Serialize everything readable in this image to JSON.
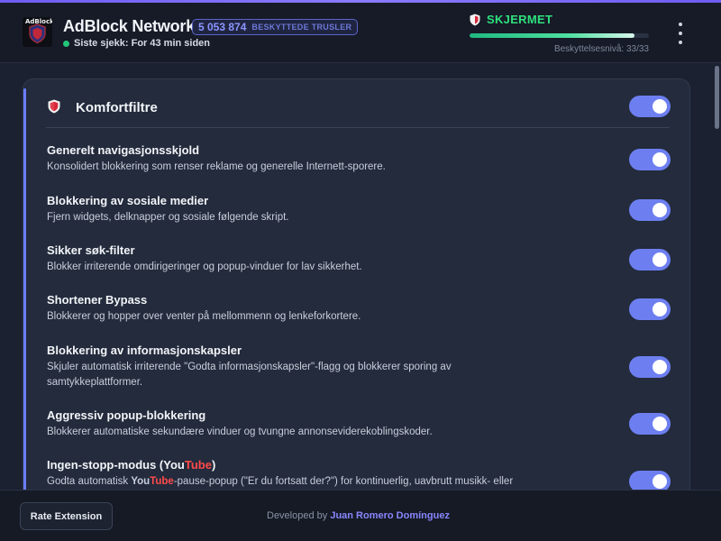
{
  "header": {
    "logo_text": "AdBlock",
    "title": "AdBlock Network",
    "threat_count": "5 053 874",
    "threat_label": "BESKYTTEDE TRUSLER",
    "last_check": "Siste sjekk: For 43 min siden",
    "status": "SKJERMET",
    "protection_level": "Beskyttelsesnivå: 33/33",
    "protection_fraction": 0.92
  },
  "card": {
    "title": "Komfortfiltre",
    "enabled": true,
    "filters": [
      {
        "title": "Generelt navigasjonsskjold",
        "desc": "Konsolidert blokkering som renser reklame og generelle Internett-sporere.",
        "enabled": true
      },
      {
        "title": "Blokkering av sosiale medier",
        "desc": "Fjern widgets, delknapper og sosiale følgende skript.",
        "enabled": true
      },
      {
        "title": "Sikker søk-filter",
        "desc": "Blokker irriterende omdirigeringer og popup-vinduer for lav sikkerhet.",
        "enabled": true
      },
      {
        "title": "Shortener Bypass",
        "desc": "Blokkerer og hopper over venter på mellommenn og lenkeforkortere.",
        "enabled": true
      },
      {
        "title": "Blokkering av informasjonskapsler",
        "desc": "Skjuler automatisk irriterende \"Godta informasjonskapsler\"-flagg og blokkerer sporing av samtykkeplattformer.",
        "enabled": true
      },
      {
        "title": "Aggressiv popup-blokkering",
        "desc": "Blokkerer automatiske sekundære vinduer og tvungne annonseviderekoblingskoder.",
        "enabled": true
      }
    ],
    "youtube_filter": {
      "title_before": "Ingen-stopp-modus (",
      "title_you": "You",
      "title_tube": "Tube",
      "title_after": ")",
      "desc_you": "You",
      "desc_tube": "Tube",
      "desc_after": "-pause-popup (\"Er du fortsatt der?\") for kontinuerlig, uavbrutt musikk- eller",
      "desc_before": "Godta automatisk ",
      "enabled": true
    }
  },
  "footer": {
    "rate_label": "Rate Extension",
    "developed_by": "Developed by ",
    "author": "Juan Romero Domínguez"
  },
  "colors": {
    "accent": "#6d7ff0",
    "status_green": "#2fe07e",
    "youtube_red": "#ff4b4b"
  }
}
